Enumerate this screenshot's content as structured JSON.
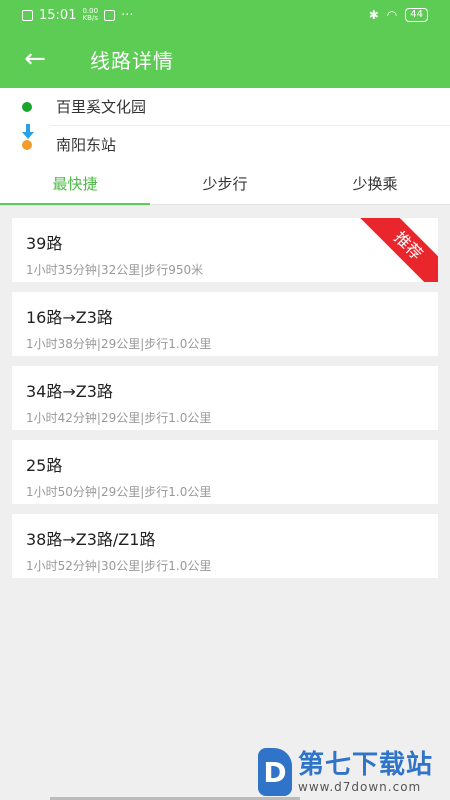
{
  "status_bar": {
    "time": "15:01",
    "net_speed_value": "0.00",
    "net_speed_unit": "KB/s",
    "dots": "···",
    "battery": "44"
  },
  "header": {
    "title": "线路详情",
    "back_icon": "←",
    "accent_color": "#5ccc55"
  },
  "stops": {
    "origin": "百里奚文化园",
    "destination": "南阳东站"
  },
  "tabs": [
    {
      "label": "最快捷",
      "active": true
    },
    {
      "label": "少步行",
      "active": false
    },
    {
      "label": "少换乘",
      "active": false
    }
  ],
  "routes": [
    {
      "name": "39路",
      "info": "1小时35分钟|32公里|步行950米",
      "badge": "推荐"
    },
    {
      "name": "16路→Z3路",
      "info": "1小时38分钟|29公里|步行1.0公里"
    },
    {
      "name": "34路→Z3路",
      "info": "1小时42分钟|29公里|步行1.0公里"
    },
    {
      "name": "25路",
      "info": "1小时50分钟|29公里|步行1.0公里"
    },
    {
      "name": "38路→Z3路/Z1路",
      "info": "1小时52分钟|30公里|步行1.0公里"
    }
  ],
  "watermark": {
    "logo": "D",
    "brand": "第七下载站",
    "url": "www.d7down.com"
  }
}
